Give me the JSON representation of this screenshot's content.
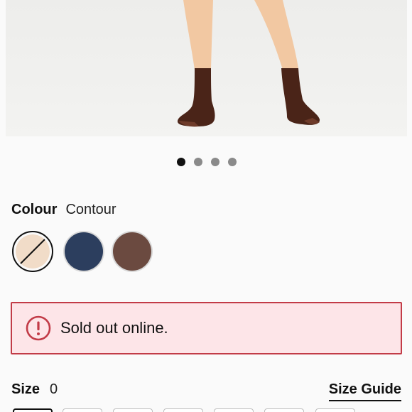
{
  "product": {
    "image_alt": "Model wearing tights",
    "carousel": {
      "count": 4,
      "active": 0
    }
  },
  "colour": {
    "label": "Colour",
    "selected": "Contour",
    "swatches": [
      {
        "name": "Contour",
        "color": "#f1dcc8",
        "selected": true,
        "sold_out": true
      },
      {
        "name": "Navy",
        "color": "#2c3e5e",
        "selected": false,
        "sold_out": false
      },
      {
        "name": "Brown",
        "color": "#6b4a40",
        "selected": false,
        "sold_out": false
      }
    ]
  },
  "alert": {
    "icon": "exclamation-circle-icon",
    "message": "Sold out online.",
    "colors": {
      "border": "#c23b47",
      "background": "#fde5e8"
    }
  },
  "size": {
    "label": "Size",
    "selected": "0",
    "guide_label": "Size Guide"
  }
}
